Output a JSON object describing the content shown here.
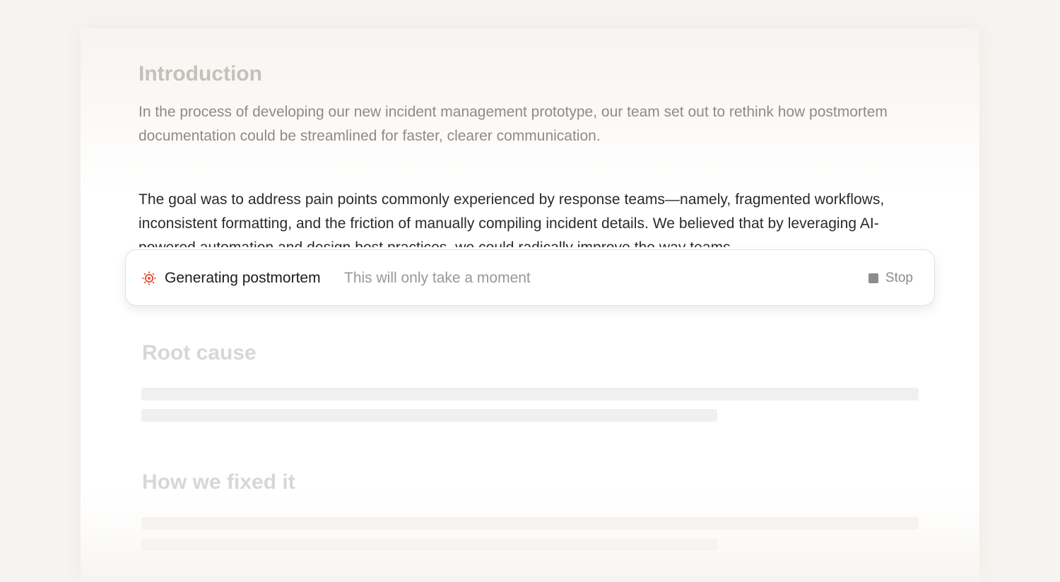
{
  "document": {
    "intro_heading": "Introduction",
    "intro_text": "In the process of developing our new incident management prototype, our team set out to rethink how postmortem documentation could be streamlined for faster, clearer communication.",
    "goal_text": "The goal was to address pain points commonly experienced by response teams—namely, fragmented workflows, inconsistent formatting, and the friction of manually compiling incident details. We believed that by leveraging AI-powered automation and design best practices, we could radically improve the way teams",
    "sections": [
      {
        "heading": "Root cause"
      },
      {
        "heading": "How we fixed it"
      }
    ]
  },
  "status": {
    "title": "Generating postmortem",
    "subtitle": "This will only take a moment",
    "stop_label": "Stop",
    "icon": "ai-sparkle-icon"
  },
  "colors": {
    "accent": "#e8553a",
    "background": "#f6f4f0"
  }
}
